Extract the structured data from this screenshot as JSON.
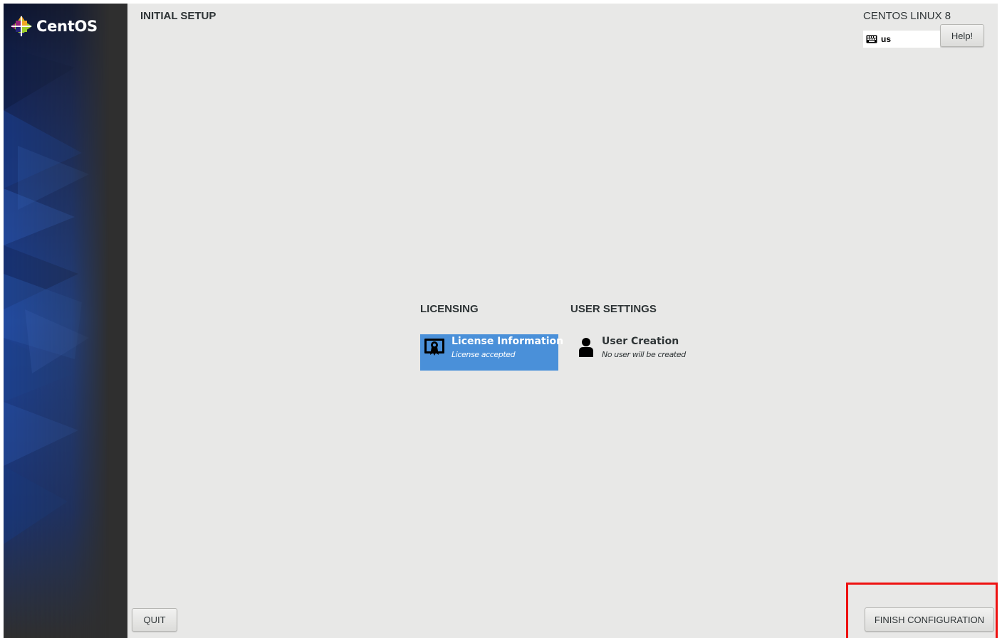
{
  "sidebar": {
    "logo_text": "CentOS"
  },
  "header": {
    "setup_title": "INITIAL SETUP",
    "product_title": "CENTOS LINUX 8",
    "keyboard_layout": "us",
    "help_label": "Help!"
  },
  "hub": {
    "categories": [
      {
        "heading": "LICENSING",
        "spokes": [
          {
            "title": "License Information",
            "status": "License accepted",
            "icon": "license-certificate-icon",
            "selected": true
          }
        ]
      },
      {
        "heading": "USER SETTINGS",
        "spokes": [
          {
            "title": "User Creation",
            "status": "No user will be created",
            "icon": "user-icon",
            "selected": false
          }
        ]
      }
    ]
  },
  "footer": {
    "quit_label": "QUIT",
    "finish_label": "FINISH CONFIGURATION"
  },
  "colors": {
    "sidebar_background": "#2f2f2f",
    "sidebar_accent": "#1c3c8c",
    "content_background": "#e8e8e7",
    "selected_spoke": "#4a90d9",
    "annotation_highlight": "#ee1111"
  }
}
